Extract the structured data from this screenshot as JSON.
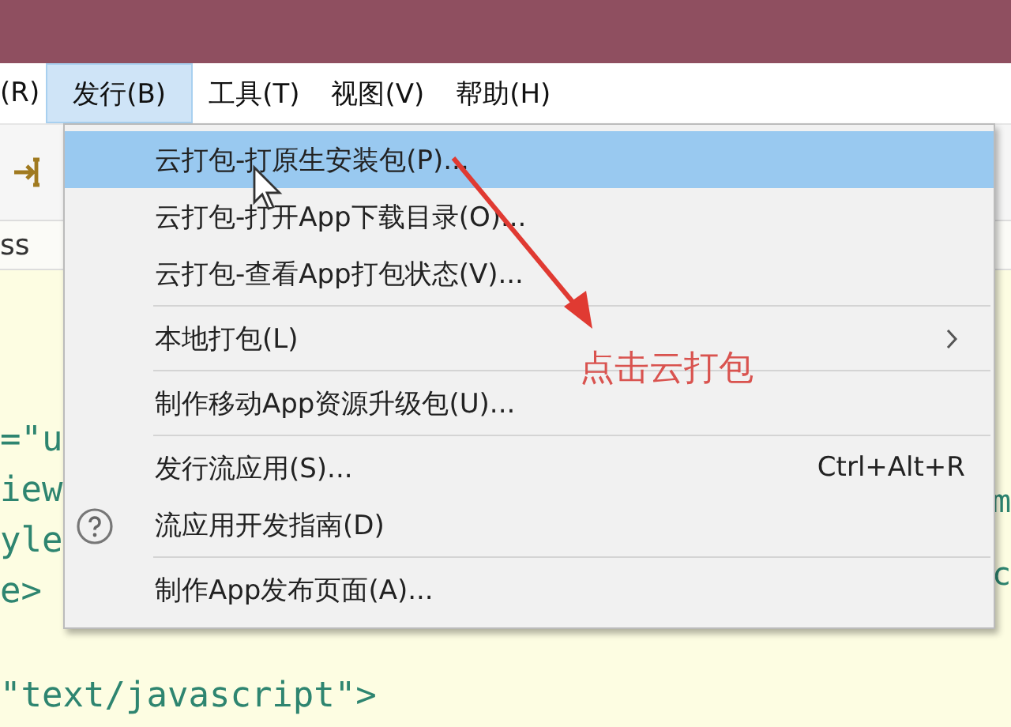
{
  "menubar": [
    {
      "label": "(R)",
      "selected": false
    },
    {
      "label": "发行(B)",
      "selected": true
    },
    {
      "label": "工具(T)",
      "selected": false
    },
    {
      "label": "视图(V)",
      "selected": false
    },
    {
      "label": "帮助(H)",
      "selected": false
    }
  ],
  "tab": {
    "label": "ss"
  },
  "code_left": [
    "=\"u",
    "iew",
    "yle",
    "e>",
    "\"text/javascript\">"
  ],
  "code_right": [
    "m",
    "c"
  ],
  "menu": [
    {
      "kind": "item",
      "label": "云打包-打原生安装包(P)...",
      "selected": true
    },
    {
      "kind": "item",
      "label": "云打包-打开App下载目录(O)...",
      "selected": false
    },
    {
      "kind": "item",
      "label": "云打包-查看App打包状态(V)...",
      "selected": false
    },
    {
      "kind": "separator"
    },
    {
      "kind": "submenu",
      "label": "本地打包(L)",
      "selected": false
    },
    {
      "kind": "separator"
    },
    {
      "kind": "item",
      "label": "制作移动App资源升级包(U)...",
      "selected": false
    },
    {
      "kind": "separator"
    },
    {
      "kind": "item",
      "label": "发行流应用(S)...",
      "shortcut": "Ctrl+Alt+R",
      "selected": false
    },
    {
      "kind": "help",
      "label": "流应用开发指南(D)",
      "selected": false
    },
    {
      "kind": "separator"
    },
    {
      "kind": "item",
      "label": "制作App发布页面(A)...",
      "selected": false
    }
  ],
  "annotation": {
    "text": "点击云打包"
  }
}
